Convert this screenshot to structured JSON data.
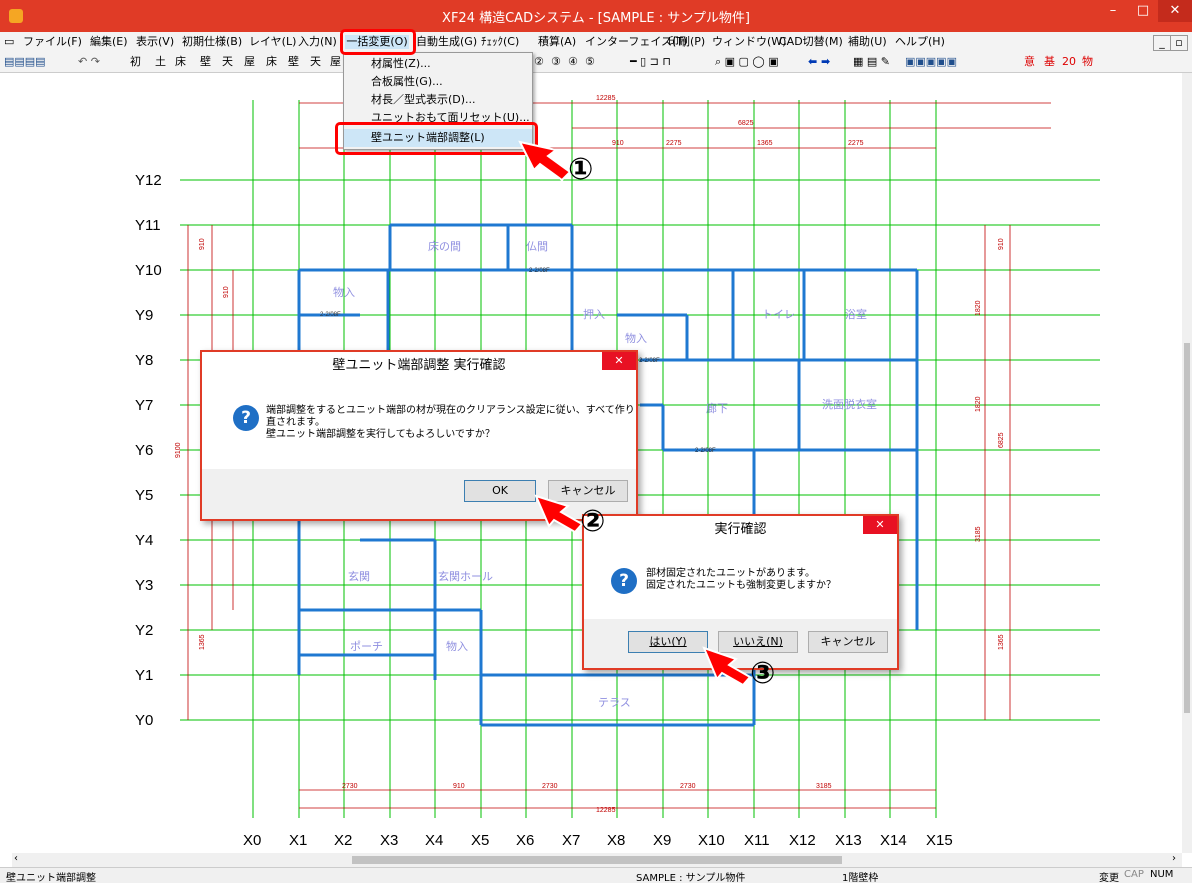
{
  "window": {
    "title": "XF24 構造CADシステム - [SAMPLE : サンプル物件]",
    "app_icon": "app-logo-icon",
    "accent": "#e03b26"
  },
  "menu": [
    {
      "label": "ファイル(F)"
    },
    {
      "label": "編集(E)"
    },
    {
      "label": "表示(V)"
    },
    {
      "label": "初期仕様(B)"
    },
    {
      "label": "レイヤ(L)"
    },
    {
      "label": "入力(N)"
    },
    {
      "label": "一括変更(O)",
      "active": true
    },
    {
      "label": "自動生成(G)"
    },
    {
      "label": "ﾁｪｯｸ(C)"
    },
    {
      "label": "積算(A)"
    },
    {
      "label": "インターフェイス(T)"
    },
    {
      "label": "印刷(P)"
    },
    {
      "label": "ウィンドウ(W)"
    },
    {
      "label": "CAD切替(M)"
    },
    {
      "label": "補助(U)"
    },
    {
      "label": "ヘルプ(H)"
    }
  ],
  "toolbar": {
    "group1": [
      "初",
      "土",
      "床",
      "壁",
      "天",
      "屋",
      "床",
      "壁",
      "天",
      "屋"
    ],
    "numbers": [
      "②",
      "③",
      "④",
      "⑤"
    ],
    "right_labels": [
      "意",
      "基",
      "20",
      "物"
    ]
  },
  "dropdown": {
    "items": [
      "材属性(Z)...",
      "合板属性(G)...",
      "材長／型式表示(D)...",
      "ユニットおもて面リセット(U)...",
      "壁ユニット端部調整(L)"
    ],
    "highlighted": 4
  },
  "grid": {
    "y_labels": [
      "Y12",
      "Y11",
      "Y10",
      "Y9",
      "Y8",
      "Y7",
      "Y6",
      "Y5",
      "Y4",
      "Y3",
      "Y2",
      "Y1",
      "Y0"
    ],
    "x_labels": [
      "X0",
      "X1",
      "X2",
      "X3",
      "X4",
      "X5",
      "X6",
      "X7",
      "X8",
      "X9",
      "X10",
      "X11",
      "X12",
      "X13",
      "X14",
      "X15"
    ]
  },
  "dimensions": {
    "top_total": "12285",
    "top_right": "6825",
    "top_parts": [
      "910",
      "2275",
      "1365",
      "2275"
    ],
    "bottom_parts": [
      "2730",
      "910",
      "2730",
      "2730",
      "3185"
    ],
    "bottom_total": "12285",
    "left": [
      "910",
      "910",
      "9100",
      "1365"
    ],
    "right": [
      "910",
      "1820",
      "1820",
      "6825",
      "3185",
      "1365"
    ]
  },
  "rooms": [
    "床の間",
    "仏間",
    "物入",
    "押入",
    "物入",
    "トイレ",
    "浴室",
    "廊下",
    "洗面脱衣室",
    "玄関",
    "玄関ホール",
    "ポーチ",
    "物入",
    "テラス"
  ],
  "beam_labels": [
    "2-2/08F",
    "2-2/08F",
    "2-2/08F",
    "2-2/08F"
  ],
  "dialog1": {
    "title": "壁ユニット端部調整 実行確認",
    "message": [
      "端部調整をするとユニット端部の材が現在のクリアランス設定に従い、すべて作り",
      "直されます。",
      "壁ユニット端部調整を実行してもよろしいですか？"
    ],
    "ok": "OK",
    "cancel": "キャンセル"
  },
  "dialog2": {
    "title": "実行確認",
    "message": [
      "部材固定されたユニットがあります。",
      "固定されたユニットも強制変更しますか？"
    ],
    "yes": "はい(Y)",
    "no": "いいえ(N)",
    "cancel": "キャンセル"
  },
  "callouts": [
    "①",
    "②",
    "③"
  ],
  "status": {
    "left": "壁ユニット端部調整",
    "project": "SAMPLE : サンプル物件",
    "layer": "1階壁枠",
    "mode": "変更",
    "cap": "CAP",
    "num": "NUM"
  },
  "colors": {
    "grid": "#00c000",
    "dim": "#c00000",
    "wall": "#1f78d1",
    "annotation": "#ff0000"
  }
}
